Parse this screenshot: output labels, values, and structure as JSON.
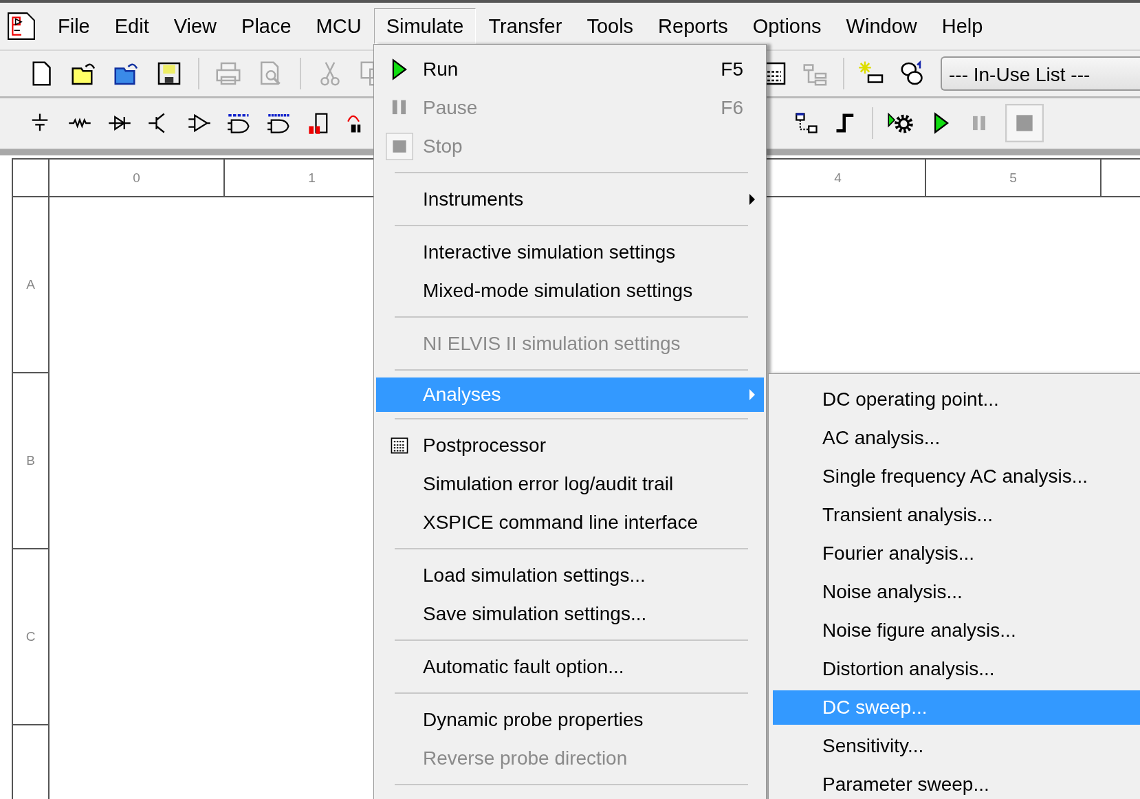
{
  "menu_bar": [
    {
      "label": "File",
      "selected": false
    },
    {
      "label": "Edit",
      "selected": false
    },
    {
      "label": "View",
      "selected": false
    },
    {
      "label": "Place",
      "selected": false
    },
    {
      "label": "MCU",
      "selected": false
    },
    {
      "label": "Simulate",
      "selected": true
    },
    {
      "label": "Transfer",
      "selected": false
    },
    {
      "label": "Tools",
      "selected": false
    },
    {
      "label": "Reports",
      "selected": false
    },
    {
      "label": "Options",
      "selected": false
    },
    {
      "label": "Window",
      "selected": false
    },
    {
      "label": "Help",
      "selected": false
    }
  ],
  "toolbar": {
    "in_use_list": {
      "value": "--- In-Use List ---"
    }
  },
  "sheet": {
    "columns": [
      "0",
      "1",
      "4",
      "5"
    ],
    "rows": [
      "A",
      "B",
      "C"
    ]
  },
  "simulate_menu": {
    "items": [
      {
        "kind": "item",
        "label": "Run",
        "shortcut": "F5",
        "disabled": false,
        "submenu": false,
        "selected": false
      },
      {
        "kind": "item",
        "label": "Pause",
        "shortcut": "F6",
        "disabled": true,
        "submenu": false,
        "selected": false
      },
      {
        "kind": "item",
        "label": "Stop",
        "disabled": true,
        "submenu": false,
        "selected": false
      },
      {
        "kind": "separator"
      },
      {
        "kind": "item",
        "label": "Instruments",
        "disabled": false,
        "submenu": true,
        "selected": false
      },
      {
        "kind": "separator"
      },
      {
        "kind": "item",
        "label": "Interactive simulation settings",
        "disabled": false,
        "submenu": false,
        "selected": false
      },
      {
        "kind": "item",
        "label": "Mixed-mode simulation settings",
        "disabled": false,
        "submenu": false,
        "selected": false
      },
      {
        "kind": "separator"
      },
      {
        "kind": "item",
        "label": "NI ELVIS II simulation settings",
        "disabled": true,
        "submenu": false,
        "selected": false
      },
      {
        "kind": "separator"
      },
      {
        "kind": "item",
        "label": "Analyses",
        "disabled": false,
        "submenu": true,
        "selected": true
      },
      {
        "kind": "separator"
      },
      {
        "kind": "item",
        "label": "Postprocessor",
        "disabled": false,
        "submenu": false,
        "selected": false
      },
      {
        "kind": "item",
        "label": "Simulation error log/audit trail",
        "disabled": false,
        "submenu": false,
        "selected": false
      },
      {
        "kind": "item",
        "label": "XSPICE command line interface",
        "disabled": false,
        "submenu": false,
        "selected": false
      },
      {
        "kind": "separator"
      },
      {
        "kind": "item",
        "label": "Load simulation settings...",
        "disabled": false,
        "submenu": false,
        "selected": false
      },
      {
        "kind": "item",
        "label": "Save simulation settings...",
        "disabled": false,
        "submenu": false,
        "selected": false
      },
      {
        "kind": "separator"
      },
      {
        "kind": "item",
        "label": "Automatic fault option...",
        "disabled": false,
        "submenu": false,
        "selected": false
      },
      {
        "kind": "separator"
      },
      {
        "kind": "item",
        "label": "Dynamic probe properties",
        "disabled": false,
        "submenu": false,
        "selected": false
      },
      {
        "kind": "item",
        "label": "Reverse probe direction",
        "disabled": true,
        "submenu": false,
        "selected": false
      },
      {
        "kind": "separator"
      }
    ]
  },
  "analyses_menu": {
    "items": [
      {
        "label": "DC operating point...",
        "selected": false
      },
      {
        "label": "AC analysis...",
        "selected": false
      },
      {
        "label": "Single frequency AC analysis...",
        "selected": false
      },
      {
        "label": "Transient analysis...",
        "selected": false
      },
      {
        "label": "Fourier analysis...",
        "selected": false
      },
      {
        "label": "Noise analysis...",
        "selected": false
      },
      {
        "label": "Noise figure analysis...",
        "selected": false
      },
      {
        "label": "Distortion analysis...",
        "selected": false
      },
      {
        "label": "DC sweep...",
        "selected": true
      },
      {
        "label": "Sensitivity...",
        "selected": false
      },
      {
        "label": "Parameter sweep...",
        "selected": false
      }
    ]
  }
}
